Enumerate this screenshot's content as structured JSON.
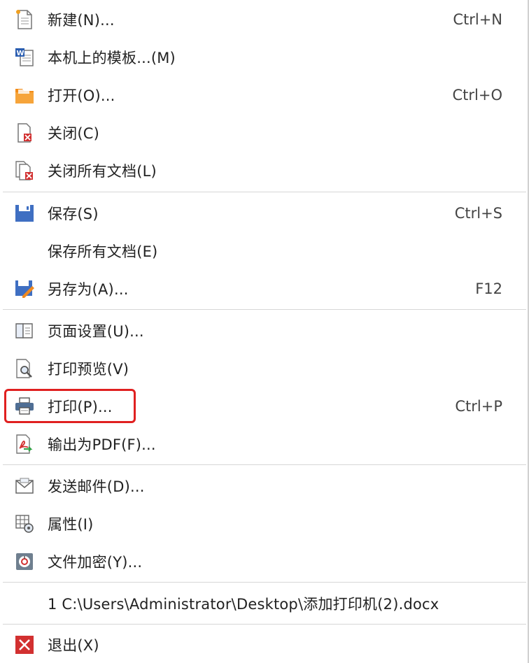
{
  "menu": {
    "items": [
      {
        "label": "新建(N)...",
        "shortcut": "Ctrl+N",
        "icon": "new-document-icon"
      },
      {
        "label": "本机上的模板...(M)",
        "shortcut": "",
        "icon": "template-icon"
      },
      {
        "label": "打开(O)...",
        "shortcut": "Ctrl+O",
        "icon": "open-folder-icon"
      },
      {
        "label": "关闭(C)",
        "shortcut": "",
        "icon": "close-document-icon"
      },
      {
        "label": "关闭所有文档(L)",
        "shortcut": "",
        "icon": "close-all-documents-icon"
      },
      {
        "label": "保存(S)",
        "shortcut": "Ctrl+S",
        "icon": "save-icon"
      },
      {
        "label": "保存所有文档(E)",
        "shortcut": "",
        "icon": ""
      },
      {
        "label": "另存为(A)...",
        "shortcut": "F12",
        "icon": "save-as-icon"
      },
      {
        "label": "页面设置(U)...",
        "shortcut": "",
        "icon": "page-setup-icon"
      },
      {
        "label": "打印预览(V)",
        "shortcut": "",
        "icon": "print-preview-icon"
      },
      {
        "label": "打印(P)...",
        "shortcut": "Ctrl+P",
        "icon": "printer-icon"
      },
      {
        "label": "输出为PDF(F)...",
        "shortcut": "",
        "icon": "export-pdf-icon"
      },
      {
        "label": "发送邮件(D)...",
        "shortcut": "",
        "icon": "email-icon"
      },
      {
        "label": "属性(I)",
        "shortcut": "",
        "icon": "properties-icon"
      },
      {
        "label": "文件加密(Y)...",
        "shortcut": "",
        "icon": "encrypt-file-icon"
      },
      {
        "label": "1 C:\\Users\\Administrator\\Desktop\\添加打印机(2).docx",
        "shortcut": "",
        "icon": ""
      },
      {
        "label": "退出(X)",
        "shortcut": "",
        "icon": "exit-icon"
      }
    ],
    "highlight_color": "#e02020"
  }
}
